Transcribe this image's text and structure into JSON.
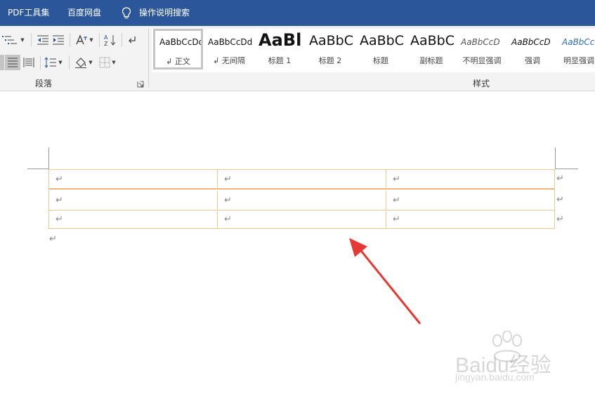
{
  "menubar": {
    "items": [
      "PDF工具集",
      "百度网盘",
      "操作说明搜索"
    ]
  },
  "ribbon": {
    "paragraph_group_label": "段落",
    "styles_group_label": "样式",
    "styles": [
      {
        "preview": "AaBbCcDd",
        "name": "↲ 正文",
        "active": true
      },
      {
        "preview": "AaBbCcDd",
        "name": "↲ 无间隔"
      },
      {
        "preview": "AaBl",
        "name": "标题 1"
      },
      {
        "preview": "AaBbC",
        "name": "标题 2"
      },
      {
        "preview": "AaBbC",
        "name": "标题"
      },
      {
        "preview": "AaBbC",
        "name": "副标题"
      },
      {
        "preview": "AaBbCcD",
        "name": "不明显强调"
      },
      {
        "preview": "AaBbCcD",
        "name": "强调"
      },
      {
        "preview": "AaBbCcD",
        "name": "明显强调"
      }
    ]
  },
  "document": {
    "cell_mark": "↵",
    "rows": 3,
    "columns": 3
  },
  "colors": {
    "title_bar": "#2b579a",
    "table_border": "#f0c998",
    "arrow": "#e53935"
  },
  "watermark": {
    "brand": "Baidu经验",
    "url": "jingyan.baidu.com"
  }
}
